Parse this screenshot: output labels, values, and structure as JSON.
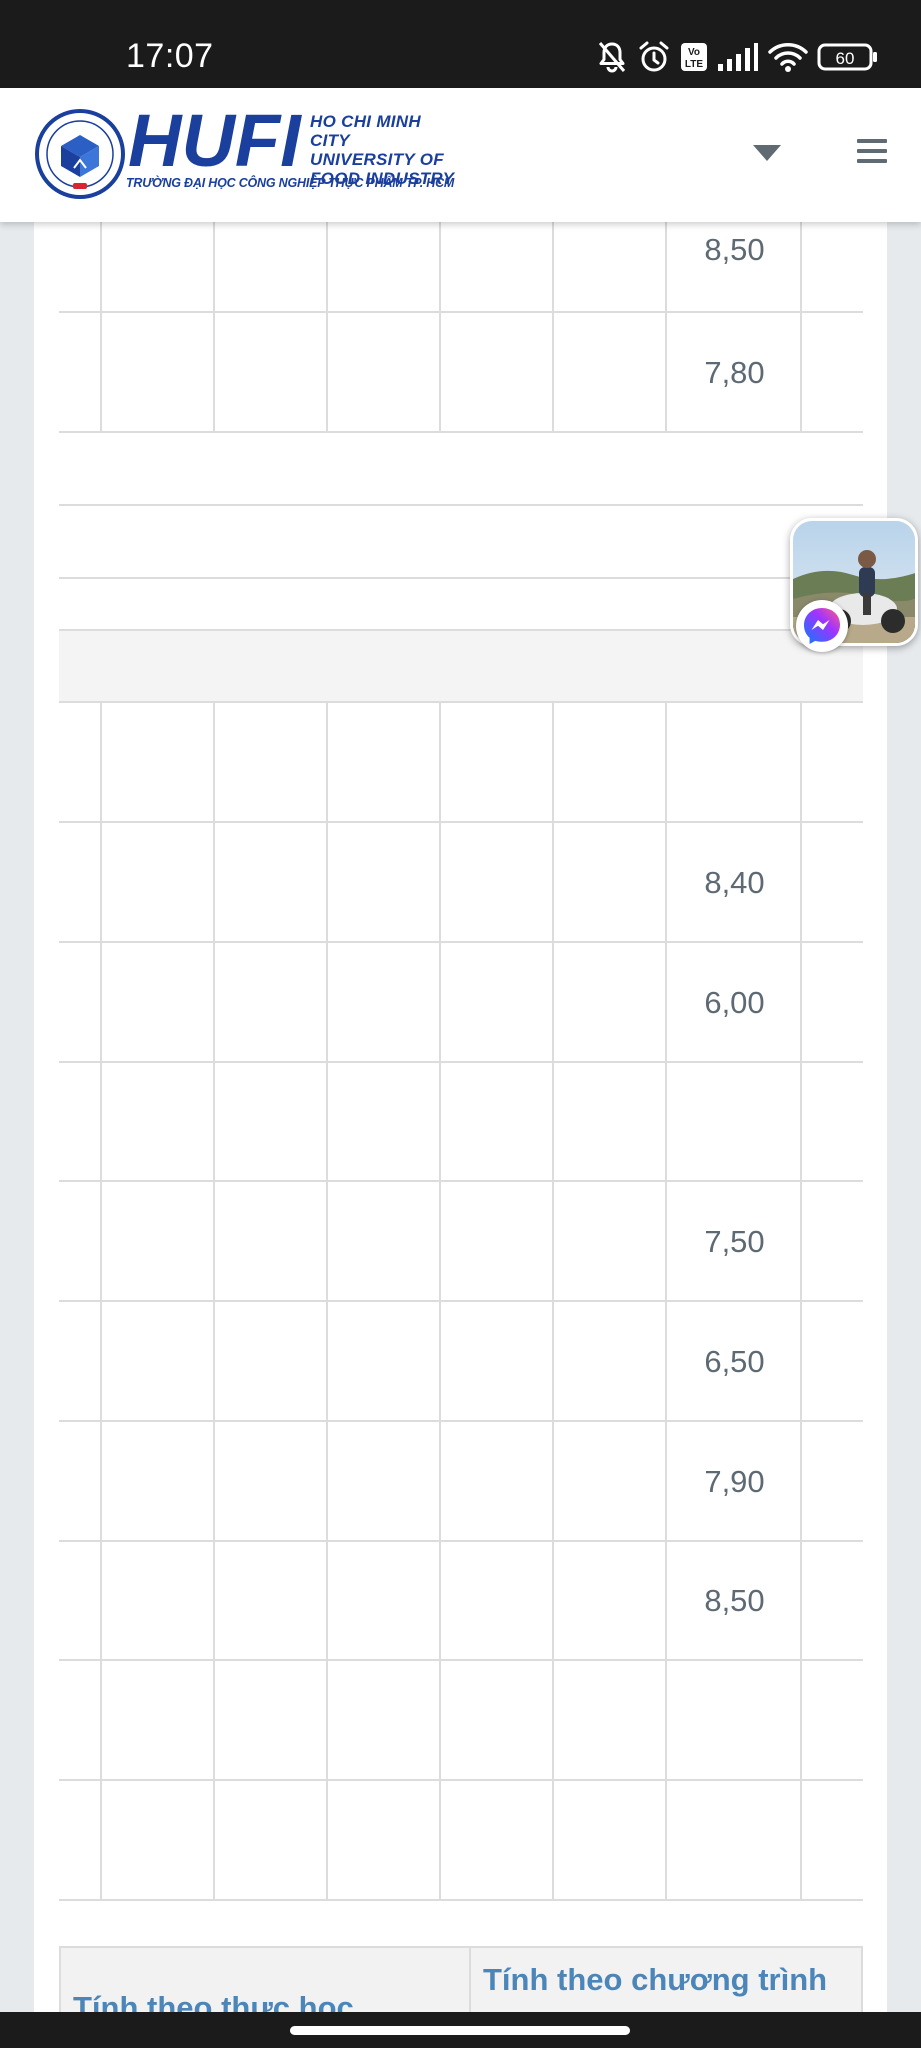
{
  "status_bar": {
    "time": "17:07",
    "battery": "60",
    "volte_label": "Vo\nLTE"
  },
  "header": {
    "logo_word": "HUFI",
    "logo_en_lines": [
      "HO CHI MINH CITY",
      "UNIVERSITY OF",
      "FOOD INDUSTRY"
    ],
    "logo_vn": "TRƯỜNG ĐẠI HỌC CÔNG NGHIỆP THỰC PHẨM TP. HCM",
    "dropdown_icon": "caret-down-icon",
    "menu_icon": "hamburger-menu-icon"
  },
  "grades_table": {
    "rows": [
      {
        "score": "8,50"
      },
      {
        "score": "7,80"
      },
      {
        "score": ""
      },
      {
        "score": ""
      },
      {
        "score": ""
      },
      {
        "score": ""
      },
      {
        "score": "8,40"
      },
      {
        "score": "6,00"
      },
      {
        "score": ""
      },
      {
        "score": "7,50"
      },
      {
        "score": "6,50"
      },
      {
        "score": "7,90"
      },
      {
        "score": "8,50"
      },
      {
        "score": ""
      },
      {
        "score": ""
      }
    ]
  },
  "summary_table": {
    "col1_header": "Tính theo thực học",
    "col2_header": "Tính theo chương trình"
  },
  "chat_head": {
    "badge_icon": "messenger-icon"
  },
  "colors": {
    "brand_blue": "#1a3f9c",
    "header_text_blue": "#4c86b9",
    "grid_line": "#dcdcdc",
    "score_text": "#5e6a73",
    "page_bg": "#e6eaed"
  }
}
